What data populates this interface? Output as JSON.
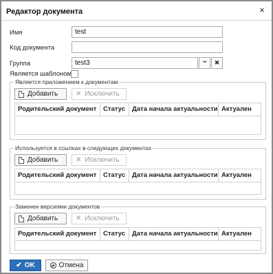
{
  "dialog": {
    "title": "Редактор документа",
    "close_glyph": "×"
  },
  "form": {
    "name_label": "Имя",
    "name_value": "test",
    "code_label": "Код документа",
    "code_value": "",
    "group_label": "Группа",
    "group_value": "test3",
    "group_browse_glyph": "•••",
    "group_clear_glyph": "✖",
    "template_label": "Является шаблоном",
    "template_checked": false
  },
  "sections": [
    {
      "legend": "Является приложением к документам",
      "add_label": "Добавить",
      "exclude_label": "Исключить",
      "columns": [
        "Родительский документ",
        "Статус",
        "Дата начала актуальности",
        "Актуален"
      ]
    },
    {
      "legend": "Используется в ссылках в следующих документах",
      "add_label": "Добавить",
      "exclude_label": "Исключить",
      "columns": [
        "Родительский документ",
        "Статус",
        "Дата начала актуальности",
        "Актуален"
      ]
    },
    {
      "legend": "Заменен версиями документов",
      "add_label": "Добавить",
      "exclude_label": "Исключить",
      "columns": [
        "Родительский документ",
        "Статус",
        "Дата начала актуальности",
        "Актуален"
      ]
    }
  ],
  "footer": {
    "ok_label": "OK",
    "cancel_label": "Отмена"
  },
  "colors": {
    "primary": "#2d6fb8",
    "border": "#a9a9a9"
  },
  "icons": {
    "add": "document-icon",
    "exclude": "x-icon",
    "ok": "check-icon",
    "cancel": "ban-icon",
    "close": "close-icon"
  }
}
